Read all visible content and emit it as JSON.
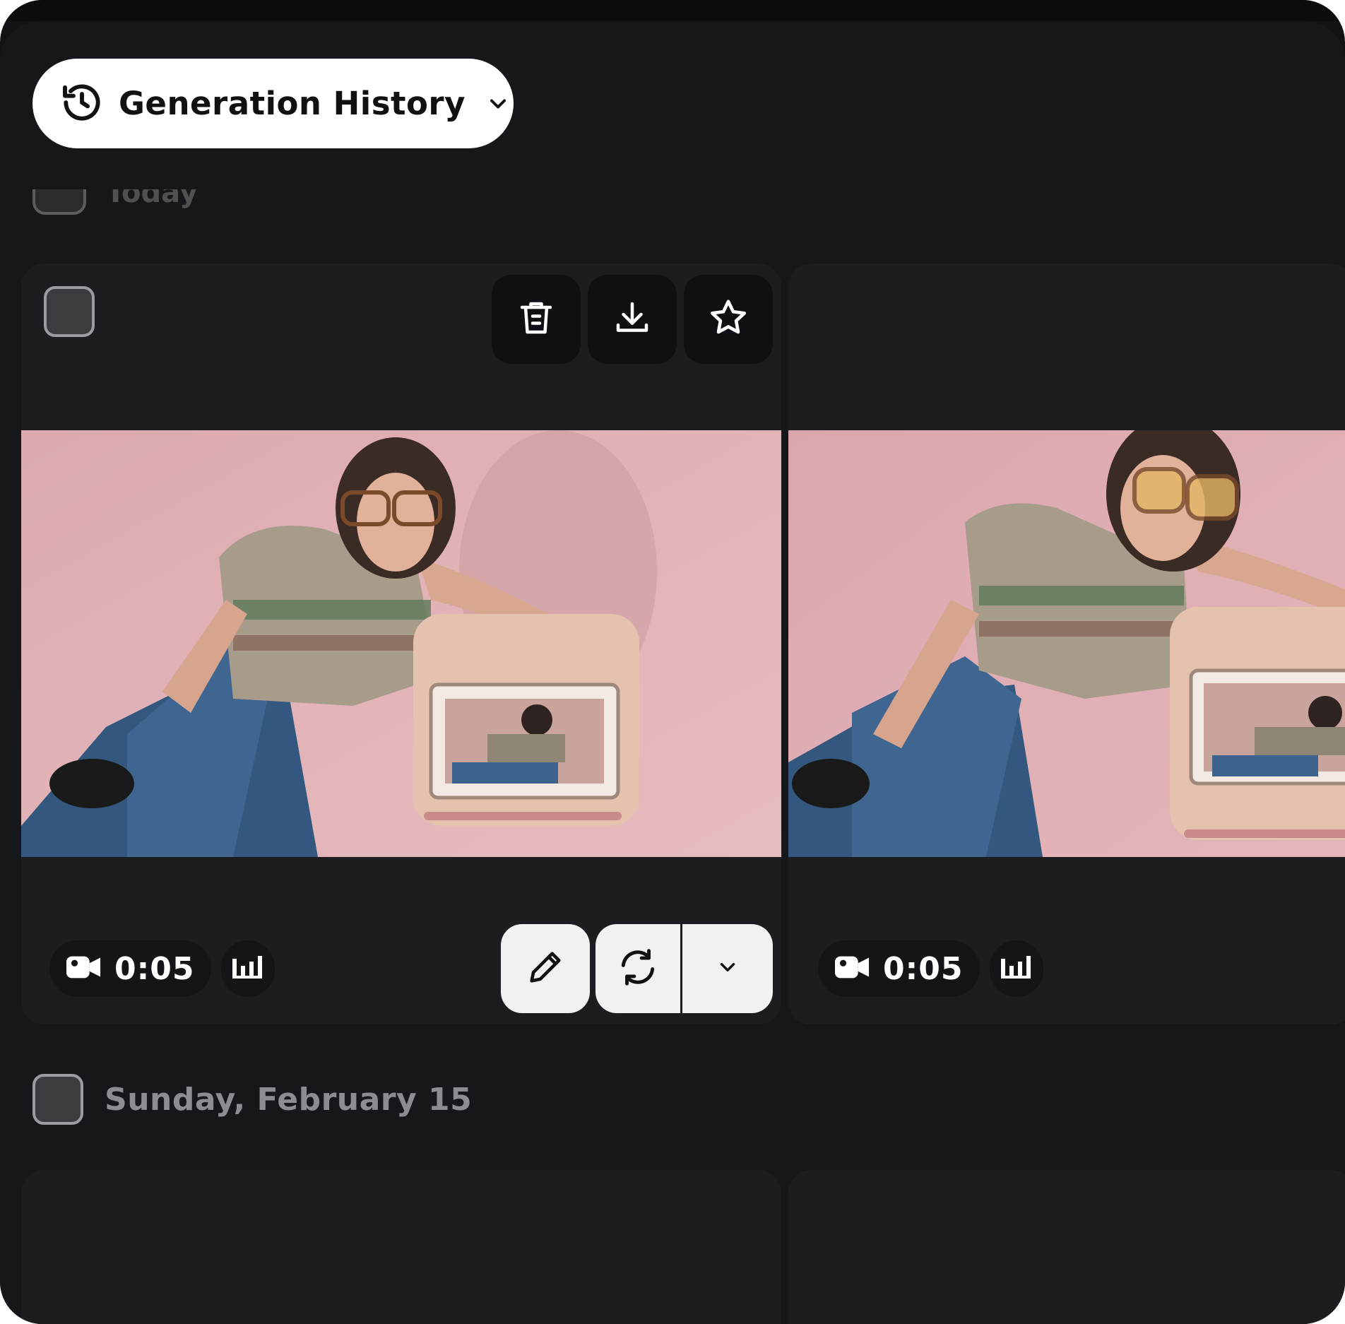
{
  "header": {
    "history_label": "Generation History"
  },
  "section_prev": {
    "label": "Today"
  },
  "cards": [
    {
      "duration": "0:05"
    },
    {
      "duration": "0:05"
    }
  ],
  "section_next": {
    "date_label": "Sunday, February 15"
  },
  "colors": {
    "background": "#16171a",
    "card": "#1c1d21",
    "button_dark": "#0f1013",
    "button_light": "#f1f1f1",
    "text_muted": "#8c8d92"
  },
  "icons": [
    "history-icon",
    "chevron-down-icon",
    "trash-icon",
    "download-icon",
    "star-icon",
    "video-camera-icon",
    "audio-bars-icon",
    "pencil-icon",
    "refresh-icon"
  ]
}
